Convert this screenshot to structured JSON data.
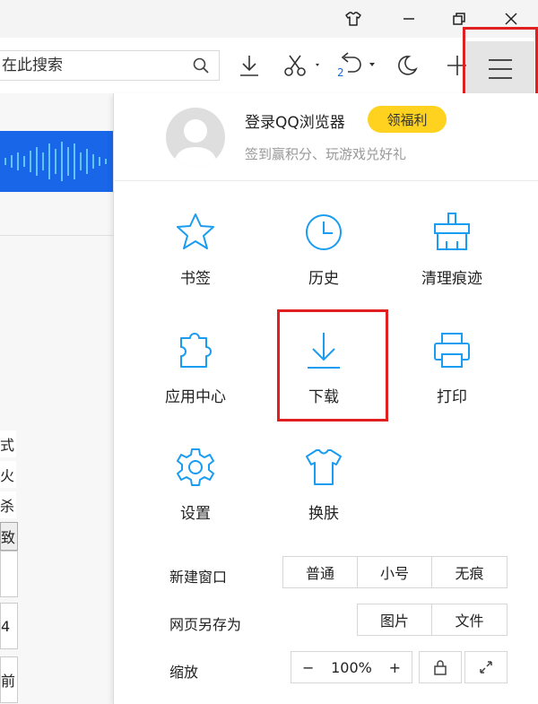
{
  "search": {
    "placeholder": "在此搜索"
  },
  "icons": {
    "skin": "tshirt-icon",
    "minimize": "minimize-icon",
    "restore": "restore-icon",
    "close": "close-icon",
    "search": "search-icon",
    "download": "download-icon",
    "scissors": "scissors-icon",
    "undo": "undo-icon",
    "night": "moon-icon",
    "new_tab": "plus-icon",
    "menu": "hamburger-menu-icon"
  },
  "toolbar": {
    "undo_count": "2"
  },
  "left_fragments": [
    "式",
    "火",
    "杀",
    "致",
    "4",
    "前"
  ],
  "menu": {
    "login_title": "登录QQ浏览器",
    "login_badge": "领福利",
    "login_subtitle": "签到赢积分、玩游戏兑好礼",
    "grid": [
      {
        "label": "书签",
        "icon": "star-icon"
      },
      {
        "label": "历史",
        "icon": "clock-icon"
      },
      {
        "label": "清理痕迹",
        "icon": "broom-icon"
      },
      {
        "label": "应用中心",
        "icon": "puzzle-icon"
      },
      {
        "label": "下载",
        "icon": "download-icon"
      },
      {
        "label": "打印",
        "icon": "printer-icon"
      },
      {
        "label": "设置",
        "icon": "gear-icon"
      },
      {
        "label": "换肤",
        "icon": "tshirt-icon"
      }
    ],
    "new_window": {
      "label": "新建窗口",
      "normal": "普通",
      "small": "小号",
      "private": "无痕"
    },
    "save_page": {
      "label": "网页另存为",
      "image": "图片",
      "file": "文件"
    },
    "zoom": {
      "label": "缩放",
      "minus": "−",
      "value": "100%",
      "plus": "+"
    }
  },
  "colors": {
    "accent": "#1a9cf0",
    "badge": "#ffd21f",
    "highlight": "#e02020",
    "banner": "#1a66e8"
  }
}
